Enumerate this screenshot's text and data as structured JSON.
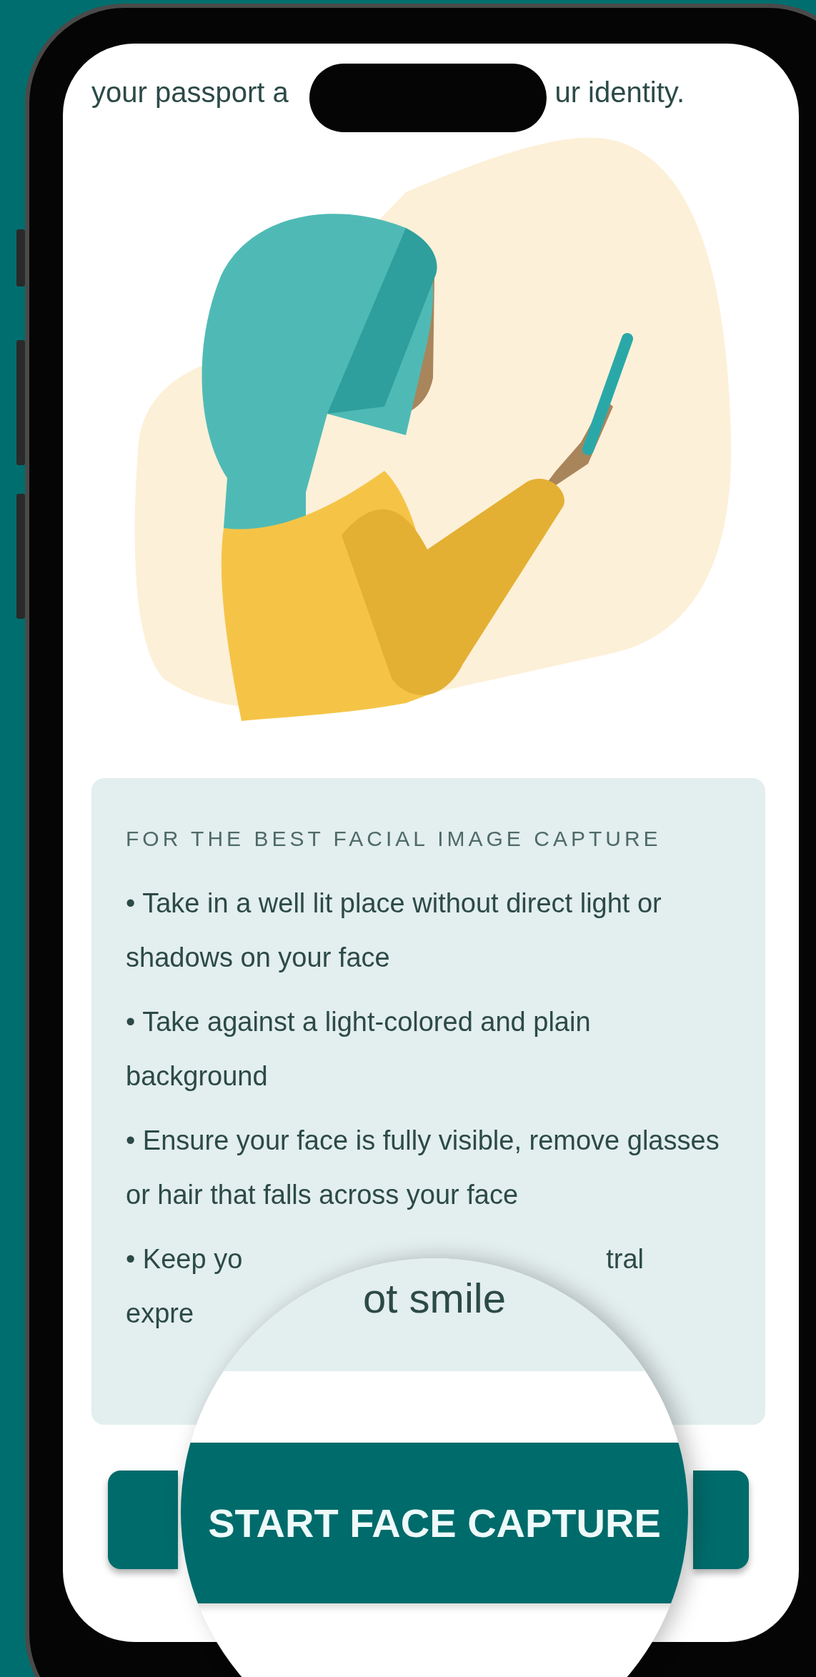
{
  "intro_text": {
    "before_notch": "your passport a",
    "after_notch": "ur identity."
  },
  "tips": {
    "heading": "FOR THE BEST FACIAL IMAGE CAPTURE",
    "items": [
      "• Take in a well lit place without direct light or shadows on your face",
      "• Take against a light-colored and plain background",
      "• Ensure your face is fully visible, remove glasses or hair that falls across your face"
    ],
    "partial_item": {
      "start": "• Keep yo",
      "end": "tral",
      "second_line": "expre"
    }
  },
  "magnifier": {
    "text": "ot smile",
    "button": "START FACE CAPTURE"
  }
}
